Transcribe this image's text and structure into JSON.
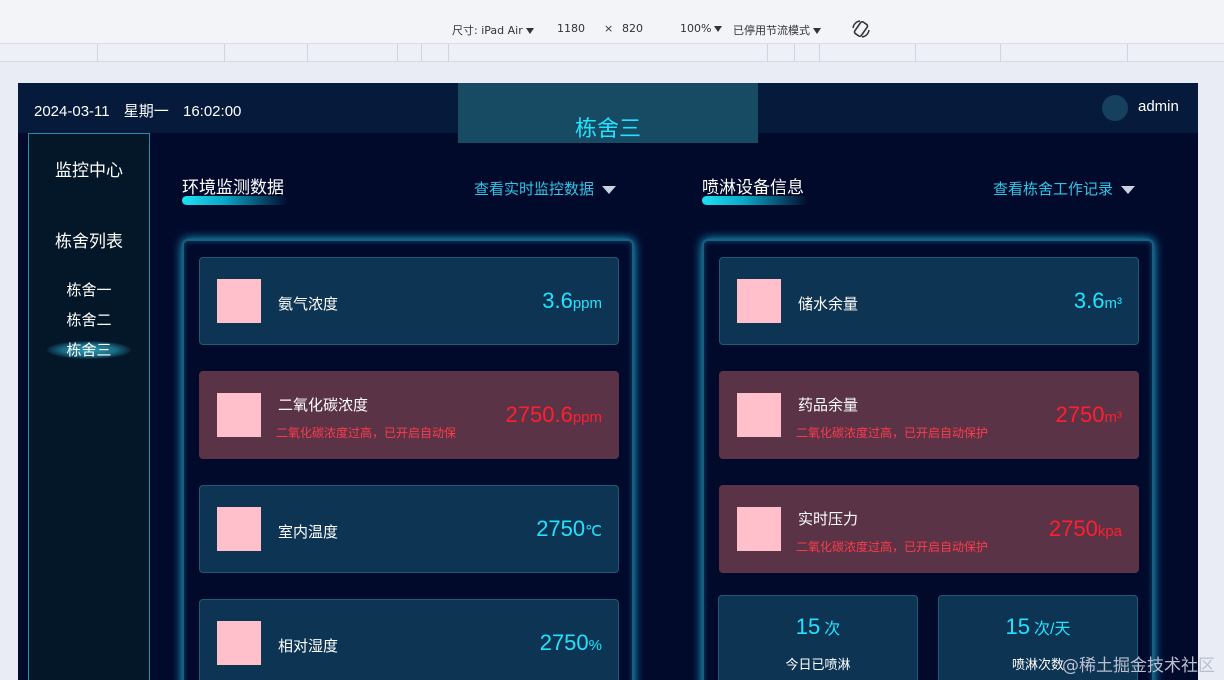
{
  "devtools": {
    "device_label": "尺寸: iPad Air",
    "width": "1180",
    "times": "×",
    "height": "820",
    "zoom": "100%",
    "throttle": "已停用节流模式"
  },
  "header": {
    "date": "2024-03-11",
    "weekday": "星期一",
    "time": "16:02:00",
    "title": "栋舍三",
    "user": "admin"
  },
  "sidebar": {
    "monitor_center": "监控中心",
    "list_title": "栋舍列表",
    "items": [
      "栋舍一",
      "栋舍二",
      "栋舍三"
    ],
    "active_index": 2
  },
  "env_section": {
    "title": "环境监测数据",
    "link": "查看实时监控数据",
    "cards": [
      {
        "name": "氨气浓度",
        "value": "3.6",
        "unit": "ppm",
        "warning": ""
      },
      {
        "name": "二氧化碳浓度",
        "value": "2750.6",
        "unit": "ppm",
        "warning": "二氧化碳浓度过高，已开启自动保"
      },
      {
        "name": "室内温度",
        "value": "2750",
        "unit": "℃",
        "warning": ""
      },
      {
        "name": "相对湿度",
        "value": "2750",
        "unit": "%",
        "warning": ""
      }
    ]
  },
  "spray_section": {
    "title": "喷淋设备信息",
    "link": "查看栋舍工作记录",
    "cards": [
      {
        "name": "储水余量",
        "value": "3.6",
        "unit": "m³",
        "warning": ""
      },
      {
        "name": "药品余量",
        "value": "2750",
        "unit": "m³",
        "warning": "二氧化碳浓度过高，已开启自动保护"
      },
      {
        "name": "实时压力",
        "value": "2750",
        "unit": "kpa",
        "warning": "二氧化碳浓度过高，已开启自动保护"
      }
    ],
    "stats": [
      {
        "value": "15",
        "unit": "次",
        "label": "今日已喷淋"
      },
      {
        "value": "15",
        "unit": "次/天",
        "label": "喷淋次数"
      }
    ]
  },
  "watermark": "@稀土掘金技术社区",
  "colors": {
    "accent": "#22e3ff",
    "alert": "#ff1f2f",
    "background": "#020a2c",
    "card": "#0d3553",
    "card_warn": "#5a3346"
  }
}
